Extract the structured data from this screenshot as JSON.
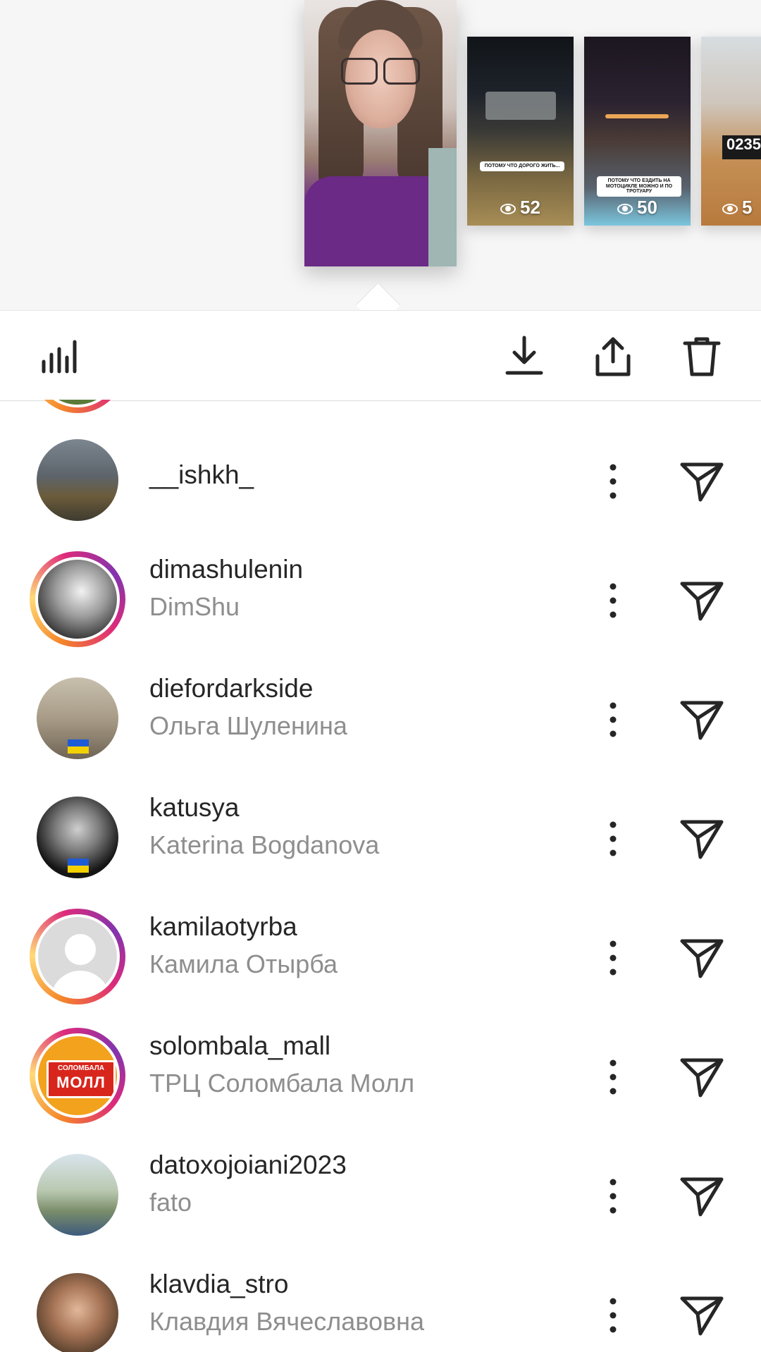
{
  "stories": [
    {
      "id": "current",
      "caption": "",
      "views": ""
    },
    {
      "id": "story-2",
      "caption": "ПОТОМУ ЧТО ДОРОГО ЖИТЬ...",
      "views": "52"
    },
    {
      "id": "story-3",
      "caption": "ПОТОМУ ЧТО ЕЗДИТЬ НА МОТОЦИКЛЕ МОЖНО И ПО ТРОТУАРУ",
      "views": "50"
    },
    {
      "id": "story-4",
      "caption": "",
      "views": "5",
      "price_tag": "0235"
    }
  ],
  "toolbar": {
    "icons": [
      "bar-chart-icon",
      "download-icon",
      "share-icon",
      "trash-icon"
    ]
  },
  "viewers": [
    {
      "username": "__ishkh_",
      "fullname": "",
      "ring": false
    },
    {
      "username": "dimashulenin",
      "fullname": "DimShu",
      "ring": true
    },
    {
      "username": "diefordarkside",
      "fullname": "Ольга Шуленина",
      "ring": false
    },
    {
      "username": "katusya",
      "fullname": "Katerina Bogdanova",
      "ring": false
    },
    {
      "username": "kamilaotyrba",
      "fullname": "Камила Отырба",
      "ring": true
    },
    {
      "username": "solombala_mall",
      "fullname": "ТРЦ Соломбала Молл",
      "ring": true,
      "logo_text": [
        "СОЛОМБАЛА",
        "МОЛЛ"
      ]
    },
    {
      "username": "datoxojoiani2023",
      "fullname": "fato",
      "ring": false
    },
    {
      "username": "klavdia_stro",
      "fullname": "Клавдия Вячеславовна",
      "ring": false
    }
  ],
  "colors": {
    "text_primary": "#262626",
    "text_secondary": "#8e8e8e",
    "story_ring": [
      "#f58529",
      "#feda77",
      "#dd2a7b",
      "#8134af"
    ]
  }
}
